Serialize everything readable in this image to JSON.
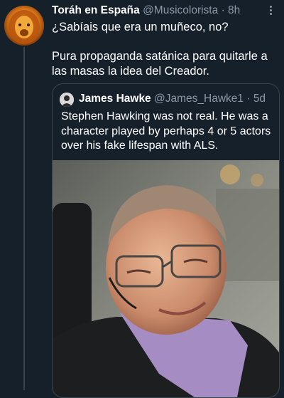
{
  "tweet": {
    "display_name": "Toráh en España",
    "handle": "@Musicolorista",
    "separator": "·",
    "time": "8h",
    "line1": "¿Sabíais que era un muñeco, no?",
    "line2": "Pura propaganda satánica para quitarle a las masas la idea del Creador."
  },
  "quoted": {
    "display_name": "James Hawke",
    "handle": "@James_Hawke1",
    "separator": "·",
    "time": "5d",
    "text": "Stephen Hawking was not real. He was a character played by perhaps 4 or 5 actors over his fake lifespan with ALS."
  },
  "colors": {
    "background": "#15202b",
    "secondary_text": "#8b98a5",
    "border": "#38444d"
  },
  "icons": {
    "avatar": "lion-avatar",
    "quoted_avatar": "person-avatar",
    "more": "more-vertical-icon"
  }
}
